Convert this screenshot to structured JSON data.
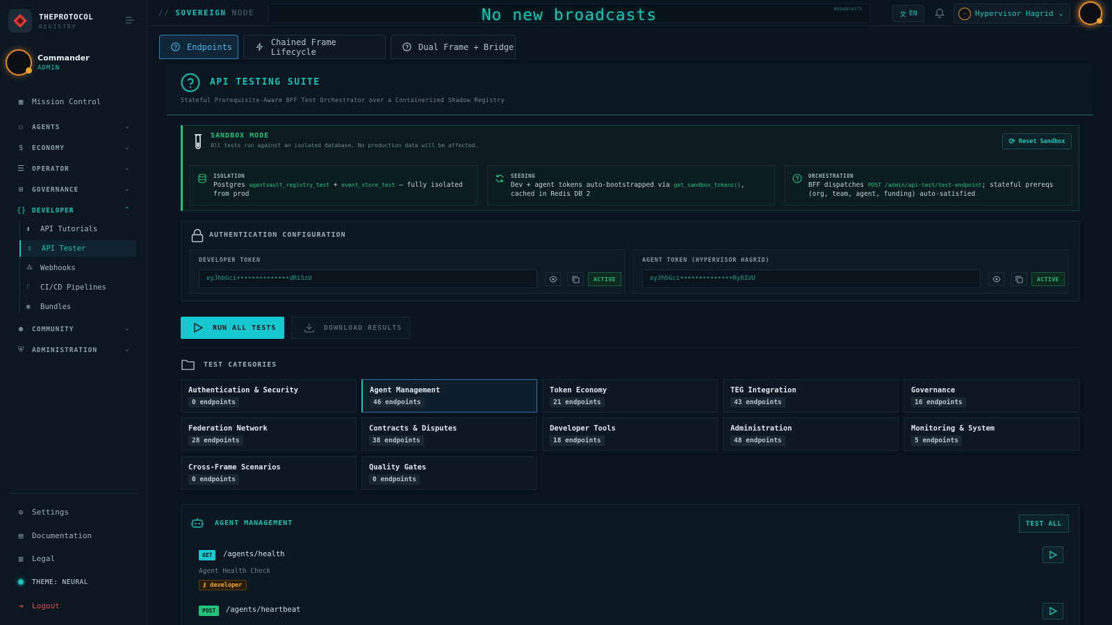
{
  "brand": {
    "name": "THEPROTOCOL",
    "subtitle": "REGISTRY"
  },
  "user": {
    "name": "Commander",
    "role": "ADMIN"
  },
  "sidebar": {
    "mission_control": "Mission Control",
    "groups": {
      "agents": "AGENTS",
      "economy": "ECONOMY",
      "operator": "OPERATOR",
      "governance": "GOVERNANCE",
      "developer": "DEVELOPER",
      "community": "COMMUNITY",
      "administration": "ADMINISTRATION"
    },
    "developer_items": [
      "API Tutorials",
      "API Tester",
      "Webhooks",
      "CI/CD Pipelines",
      "Bundles"
    ],
    "footer": {
      "settings": "Settings",
      "documentation": "Documentation",
      "legal": "Legal",
      "theme": "THEME: NEURAL",
      "logout": "Logout"
    }
  },
  "topbar": {
    "crumb_prefix": "//",
    "crumb_main": "SOVEREIGN",
    "crumb_sub": "NODE",
    "broadcast": "No new broadcasts",
    "broadcast_tag": "BROADCASTS",
    "lang": "EN",
    "account": "Hypervisor Hagrid",
    "account_initial": "-"
  },
  "tabs": [
    "Endpoints",
    "Chained Frame Lifecycle",
    "Dual Frame + Bridge"
  ],
  "header": {
    "title": "API TESTING SUITE",
    "subtitle": "Stateful Prerequisite-Aware BFF Test Orchestrator over a Containerized Shadow Registry"
  },
  "sandbox": {
    "title": "SANDBOX MODE",
    "desc": "All tests run against an isolated database. No production data will be affected.",
    "reset": "Reset Sandbox",
    "isolation": {
      "title": "ISOLATION",
      "t1": "Postgres",
      "c1": "agentvault_registry_test",
      "t2": "+",
      "c2": "event_store_test",
      "t3": "— fully isolated from prod"
    },
    "seeding": {
      "title": "SEEDING",
      "t1": "Dev + agent tokens auto-bootstrapped via",
      "c1": "get_sandbox_tokens()",
      "t2": ", cached in Redis DB 2"
    },
    "orchestration": {
      "title": "ORCHESTRATION",
      "t1": "BFF dispatches",
      "c1": "POST /admin/api-test/test-endpoint",
      "t2": "; stateful prereqs (org, team, agent, funding) auto-satisfied"
    }
  },
  "auth": {
    "title": "AUTHENTICATION CONFIGURATION",
    "dev_label": "DEVELOPER TOKEN",
    "dev_token": "eyJhbGci••••••••••••••dRiSzU",
    "agent_label": "AGENT TOKEN (HYPERVISOR HAGRID)",
    "agent_token": "eyJhbGci••••••••••••••Ry8IUU",
    "status": "ACTIVE"
  },
  "actions": {
    "run": "RUN ALL TESTS",
    "download": "DOWNLOAD RESULTS"
  },
  "categories": {
    "title": "TEST CATEGORIES",
    "items": [
      {
        "name": "Authentication & Security",
        "count": "0 endpoints"
      },
      {
        "name": "Agent Management",
        "count": "46 endpoints"
      },
      {
        "name": "Token Economy",
        "count": "21 endpoints"
      },
      {
        "name": "TEG Integration",
        "count": "43 endpoints"
      },
      {
        "name": "Governance",
        "count": "16 endpoints"
      },
      {
        "name": "Federation Network",
        "count": "28 endpoints"
      },
      {
        "name": "Contracts & Disputes",
        "count": "38 endpoints"
      },
      {
        "name": "Developer Tools",
        "count": "18 endpoints"
      },
      {
        "name": "Administration",
        "count": "48 endpoints"
      },
      {
        "name": "Monitoring & System",
        "count": "5 endpoints"
      },
      {
        "name": "Cross-Frame Scenarios",
        "count": "0 endpoints"
      },
      {
        "name": "Quality Gates",
        "count": "0 endpoints"
      }
    ]
  },
  "agent_mgmt": {
    "title": "AGENT MANAGEMENT",
    "test_all": "TEST ALL",
    "endpoints": [
      {
        "method": "GET",
        "path": "/agents/health",
        "desc": "Agent Health Check",
        "tag": "developer"
      },
      {
        "method": "POST",
        "path": "/agents/heartbeat"
      }
    ]
  },
  "colors": {
    "accent": "#18c4b8",
    "success": "#22c27b",
    "warning": "#f0a530",
    "danger": "#e0504f"
  }
}
